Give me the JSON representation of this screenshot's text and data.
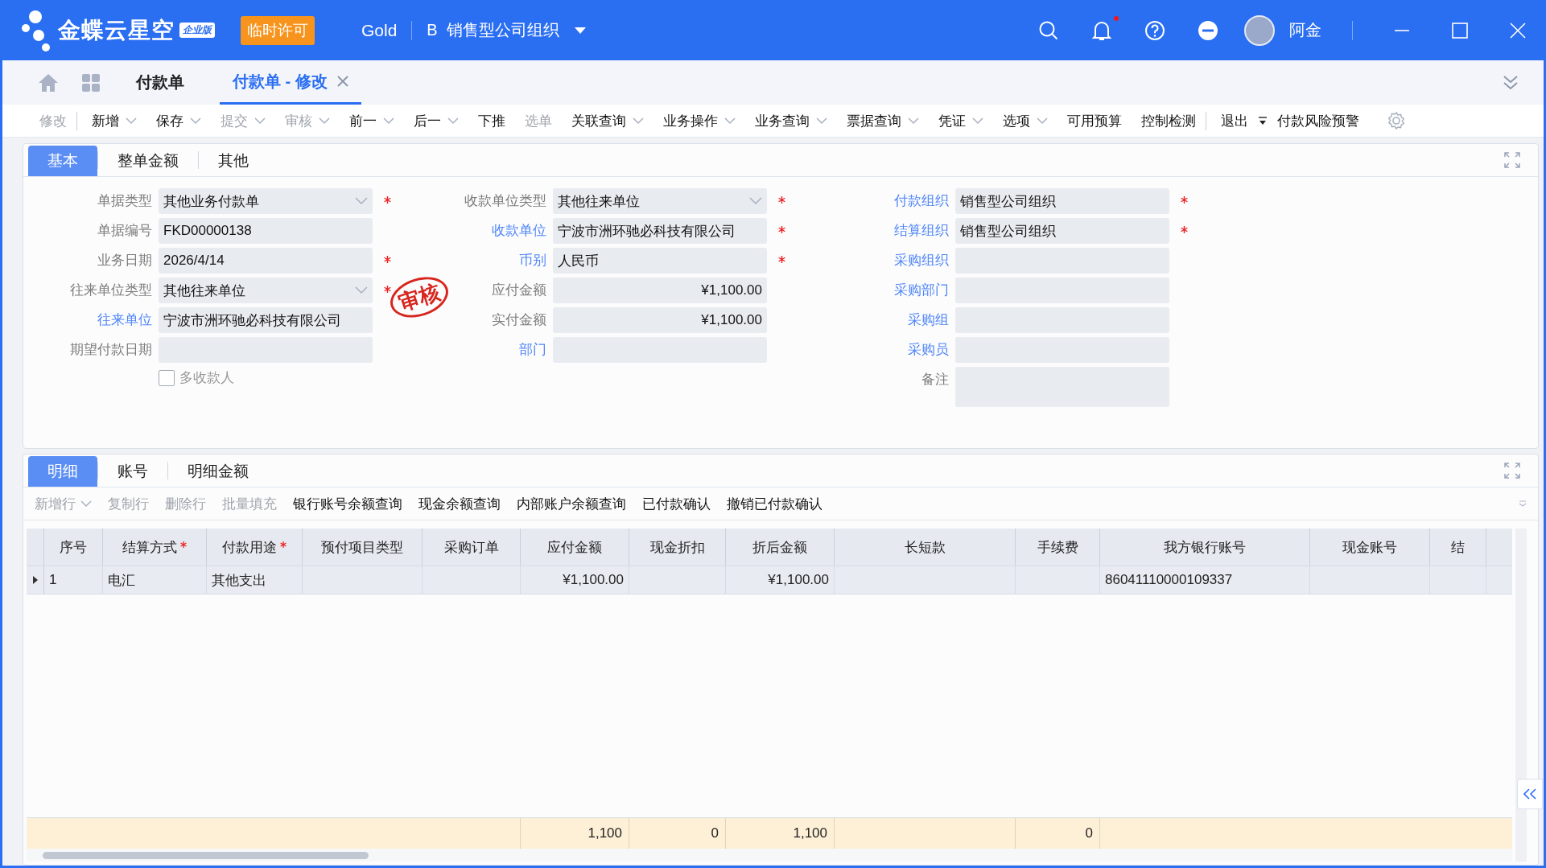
{
  "app": {
    "brand": "金蝶云星空",
    "edition": "企业版",
    "license_badge": "临时许可",
    "data_center": "Gold",
    "org": "B  销售型公司组织",
    "user": "阿金",
    "has_notification": true
  },
  "page_tabs": [
    {
      "label": "付款单",
      "selected": false,
      "closable": false
    },
    {
      "label": "付款单 - 修改",
      "selected": true,
      "closable": true
    }
  ],
  "toolbar": [
    {
      "label": "修改",
      "dropdown": false,
      "disabled": true,
      "divider_after": true
    },
    {
      "label": "新增",
      "dropdown": true,
      "disabled": false,
      "divider_after": false
    },
    {
      "label": "保存",
      "dropdown": true,
      "disabled": false,
      "divider_after": false
    },
    {
      "label": "提交",
      "dropdown": true,
      "disabled": true,
      "divider_after": false
    },
    {
      "label": "审核",
      "dropdown": true,
      "disabled": true,
      "divider_after": false
    },
    {
      "label": "前一",
      "dropdown": true,
      "disabled": false,
      "divider_after": false
    },
    {
      "label": "后一",
      "dropdown": true,
      "disabled": false,
      "divider_after": false
    },
    {
      "label": "下推",
      "dropdown": false,
      "disabled": false,
      "divider_after": false
    },
    {
      "label": "选单",
      "dropdown": false,
      "disabled": true,
      "divider_after": false
    },
    {
      "label": "关联查询",
      "dropdown": true,
      "disabled": false,
      "divider_after": false
    },
    {
      "label": "业务操作",
      "dropdown": true,
      "disabled": false,
      "divider_after": false
    },
    {
      "label": "业务查询",
      "dropdown": true,
      "disabled": false,
      "divider_after": false
    },
    {
      "label": "票据查询",
      "dropdown": true,
      "disabled": false,
      "divider_after": false
    },
    {
      "label": "凭证",
      "dropdown": true,
      "disabled": false,
      "divider_after": false
    },
    {
      "label": "选项",
      "dropdown": true,
      "disabled": false,
      "divider_after": false
    },
    {
      "label": "可用预算",
      "dropdown": false,
      "disabled": false,
      "divider_after": false
    },
    {
      "label": "控制检测",
      "dropdown": false,
      "disabled": false,
      "divider_after": true
    },
    {
      "label": "退出",
      "dropdown": false,
      "disabled": false,
      "divider_after": false
    }
  ],
  "toolbar_extra": {
    "label": "付款风险预警"
  },
  "header_tabs": [
    {
      "label": "基本",
      "selected": true
    },
    {
      "label": "整单金额",
      "selected": false
    },
    {
      "label": "其他",
      "selected": false
    }
  ],
  "form_columns": [
    {
      "fields": [
        {
          "label": "单据类型",
          "link": false,
          "kind": "select",
          "value": "其他业务付款单",
          "required": true
        },
        {
          "label": "单据编号",
          "link": false,
          "kind": "text",
          "value": "FKD00000138",
          "required": false
        },
        {
          "label": "业务日期",
          "link": false,
          "kind": "text",
          "value": "2026/4/14",
          "required": true
        },
        {
          "label": "往来单位类型",
          "link": false,
          "kind": "select",
          "value": "其他往来单位",
          "required": true
        },
        {
          "label": "往来单位",
          "link": true,
          "kind": "text",
          "value": "宁波市洲环驰必科技有限公司",
          "required": false
        },
        {
          "label": "期望付款日期",
          "link": false,
          "kind": "text",
          "required": false
        }
      ],
      "checkbox": {
        "label": "多收款人",
        "checked": false
      }
    },
    {
      "fields": [
        {
          "label": "收款单位类型",
          "link": false,
          "kind": "select",
          "value": "其他往来单位",
          "required": true
        },
        {
          "label": "收款单位",
          "link": true,
          "kind": "text",
          "value": "宁波市洲环驰必科技有限公司",
          "required": true
        },
        {
          "label": "币别",
          "link": true,
          "kind": "text",
          "value": "人民币",
          "required": true
        },
        {
          "label": "应付金额",
          "link": false,
          "kind": "amount",
          "value": "¥1,100.00",
          "required": false
        },
        {
          "label": "实付金额",
          "link": false,
          "kind": "amount",
          "value": "¥1,100.00",
          "required": false
        },
        {
          "label": "部门",
          "link": true,
          "kind": "text",
          "required": false
        }
      ]
    },
    {
      "fields": [
        {
          "label": "付款组织",
          "link": true,
          "kind": "text",
          "value": "销售型公司组织",
          "required": true
        },
        {
          "label": "结算组织",
          "link": true,
          "kind": "text",
          "value": "销售型公司组织",
          "required": true
        },
        {
          "label": "采购组织",
          "link": true,
          "kind": "text",
          "required": false
        },
        {
          "label": "采购部门",
          "link": true,
          "kind": "text",
          "required": false
        },
        {
          "label": "采购组",
          "link": true,
          "kind": "text",
          "required": false
        },
        {
          "label": "采购员",
          "link": true,
          "kind": "text",
          "required": false
        },
        {
          "label": "备注",
          "link": false,
          "kind": "textarea",
          "required": false
        }
      ]
    }
  ],
  "stamp": "审核",
  "detail_tabs": [
    {
      "label": "明细",
      "selected": true
    },
    {
      "label": "账号",
      "selected": false
    },
    {
      "label": "明细金额",
      "selected": false
    }
  ],
  "detail_toolbar": [
    {
      "label": "新增行",
      "dropdown": true,
      "disabled": true
    },
    {
      "label": "复制行",
      "dropdown": false,
      "disabled": true
    },
    {
      "label": "删除行",
      "dropdown": false,
      "disabled": true
    },
    {
      "label": "批量填充",
      "dropdown": false,
      "disabled": true
    },
    {
      "label": "银行账号余额查询",
      "dropdown": false,
      "disabled": false
    },
    {
      "label": "现金余额查询",
      "dropdown": false,
      "disabled": false
    },
    {
      "label": "内部账户余额查询",
      "dropdown": false,
      "disabled": false
    },
    {
      "label": "已付款确认",
      "dropdown": false,
      "disabled": false
    },
    {
      "label": "撤销已付款确认",
      "dropdown": false,
      "disabled": false
    }
  ],
  "grid": {
    "columns": [
      {
        "title": "序号",
        "required": false
      },
      {
        "title": "结算方式",
        "required": true
      },
      {
        "title": "付款用途",
        "required": true
      },
      {
        "title": "预付项目类型",
        "required": false
      },
      {
        "title": "采购订单",
        "required": false
      },
      {
        "title": "应付金额",
        "required": false,
        "total": "1,100"
      },
      {
        "title": "现金折扣",
        "required": false,
        "total": "0"
      },
      {
        "title": "折后金额",
        "required": false,
        "total": "1,100"
      },
      {
        "title": "长短款",
        "required": false
      },
      {
        "title": "手续费",
        "required": false,
        "total": "0"
      },
      {
        "title": "我方银行账号",
        "required": false
      },
      {
        "title": "现金账号",
        "required": false
      },
      {
        "title": "结",
        "required": false
      }
    ],
    "rows": [
      {
        "current": true,
        "cells": [
          {
            "text": "1",
            "kind": "text"
          },
          {
            "text": "电汇",
            "kind": "text"
          },
          {
            "text": "其他支出",
            "kind": "text"
          },
          {},
          {},
          {
            "text": "¥1,100.00",
            "kind": "amount"
          },
          {},
          {
            "text": "¥1,100.00",
            "kind": "amount"
          },
          {},
          {},
          {
            "text": "86041110000109337",
            "kind": "text"
          },
          {},
          {}
        ]
      }
    ]
  }
}
